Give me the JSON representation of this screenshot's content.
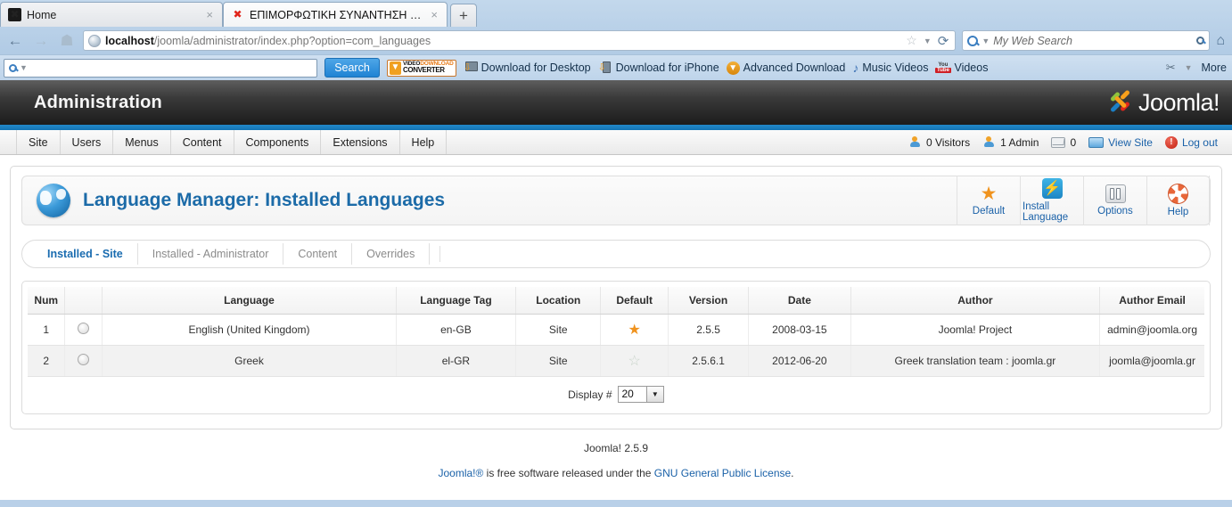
{
  "browser": {
    "tabs": [
      {
        "title": "Home",
        "favicon": "joomla-favicon",
        "active": false
      },
      {
        "title": "ΕΠΙΜΟΡΦΩΤΙΚΗ ΣΥΝΑΝΤΗΣΗ - Ad...",
        "favicon": "joomla-favicon",
        "active": true
      }
    ],
    "new_tab_label": "+",
    "close_label": "×",
    "url_prefix": "localhost",
    "url_suffix": "/joomla/administrator/index.php?option=com_languages",
    "search_placeholder": "My Web Search",
    "back_icon": "←",
    "forward_icon": "→",
    "reload_icon": "⟳",
    "star_icon": "☆",
    "caret_icon": "▼",
    "home_icon": "⌂"
  },
  "addonbar": {
    "search_value": "",
    "search_button": "Search",
    "brand_line1_a": "VIDEO",
    "brand_line1_b": "DOWNLOAD",
    "brand_line2": "CONVERTER",
    "links": [
      {
        "label": "Download for Desktop",
        "icon": "monitor-download-icon"
      },
      {
        "label": "Download for iPhone",
        "icon": "phone-download-icon"
      },
      {
        "label": "Advanced Download",
        "icon": "circle-download-icon"
      },
      {
        "label": "Music Videos",
        "icon": "music-note-icon"
      },
      {
        "label": "Videos",
        "icon": "youtube-icon"
      }
    ],
    "more_label": "More",
    "wrench_label": "✂"
  },
  "admin": {
    "header_title": "Administration",
    "logo_text": "Joomla!",
    "logo_sup": "®",
    "menu": [
      {
        "label": "Site"
      },
      {
        "label": "Users"
      },
      {
        "label": "Menus"
      },
      {
        "label": "Content"
      },
      {
        "label": "Components"
      },
      {
        "label": "Extensions"
      },
      {
        "label": "Help"
      }
    ],
    "status": {
      "visitors": "0 Visitors",
      "admins": "1 Admin",
      "messages": "0",
      "view_site": "View Site",
      "log_out": "Log out"
    }
  },
  "main": {
    "page_title": "Language Manager: Installed Languages",
    "title_icon": "globe-icon",
    "toolbar": [
      {
        "label": "Default",
        "icon": "star-icon"
      },
      {
        "label": "Install Language",
        "icon": "lightning-icon"
      },
      {
        "label": "Options",
        "icon": "options-icon"
      },
      {
        "label": "Help",
        "icon": "life-ring-icon"
      }
    ],
    "tabs": [
      {
        "label": "Installed - Site",
        "active": true
      },
      {
        "label": "Installed - Administrator",
        "active": false
      },
      {
        "label": "Content",
        "active": false
      },
      {
        "label": "Overrides",
        "active": false
      }
    ],
    "table": {
      "columns": [
        "Num",
        "",
        "Language",
        "Language Tag",
        "Location",
        "Default",
        "Version",
        "Date",
        "Author",
        "Author Email"
      ],
      "rows": [
        {
          "num": "1",
          "language": "English (United Kingdom)",
          "tag": "en-GB",
          "location": "Site",
          "default": true,
          "version": "2.5.5",
          "date": "2008-03-15",
          "author": "Joomla! Project",
          "email": "admin@joomla.org"
        },
        {
          "num": "2",
          "language": "Greek",
          "tag": "el-GR",
          "location": "Site",
          "default": false,
          "version": "2.5.6.1",
          "date": "2012-06-20",
          "author": "Greek translation team : joomla.gr",
          "email": "joomla@joomla.gr"
        }
      ]
    },
    "display": {
      "label": "Display #",
      "value": "20"
    }
  },
  "footer": {
    "version": "Joomla! 2.5.9",
    "credit_brand": "Joomla!®",
    "credit_mid": " is free software released under the ",
    "credit_link": "GNU General Public License",
    "credit_end": "."
  },
  "colors": {
    "accent_blue": "#1a6cb0",
    "star_orange": "#f0931e",
    "header_dark": "#2b2b2b",
    "rule_blue": "#1f84c6"
  }
}
